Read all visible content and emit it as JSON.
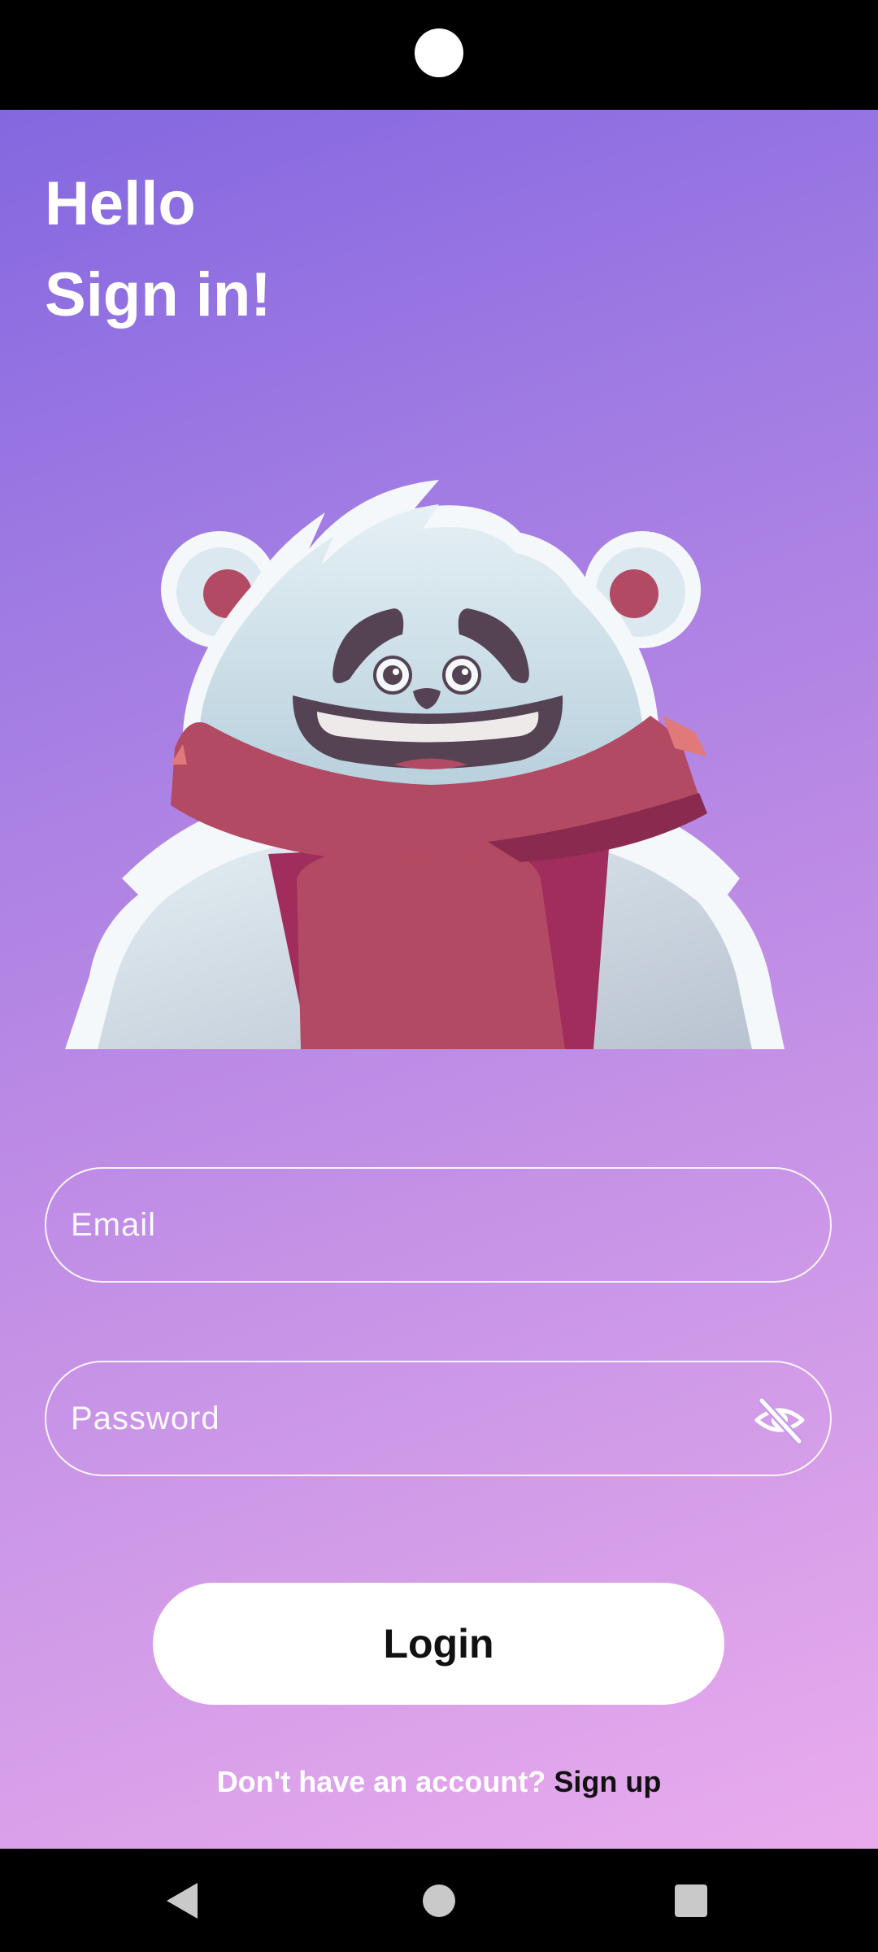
{
  "header": {
    "greeting": "Hello",
    "subtitle": "Sign in!"
  },
  "illustration": {
    "icon": "polar-bear-mascot"
  },
  "form": {
    "email": {
      "placeholder": "Email",
      "value": ""
    },
    "password": {
      "placeholder": "Password",
      "value": "",
      "toggle_icon": "eye-off-icon"
    },
    "login_label": "Login"
  },
  "footer": {
    "prompt": "Don't have an account?",
    "signup_label": "Sign up"
  },
  "system_nav": {
    "back_icon": "back-triangle-icon",
    "home_icon": "home-circle-icon",
    "recents_icon": "recents-square-icon"
  },
  "colors": {
    "gradient_start": "#8467e0",
    "gradient_end": "#e9abed",
    "button_bg": "#ffffff",
    "button_text": "#111111",
    "scarf": "#b04a62"
  }
}
